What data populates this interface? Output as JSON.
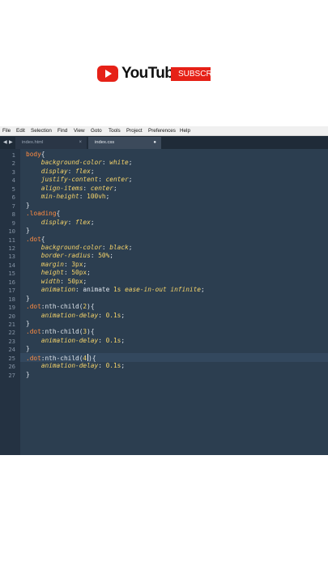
{
  "youtube": {
    "brand": "YouTube",
    "subscribe": "SUBSCR"
  },
  "menu": [
    "File",
    "Edit",
    "Selection",
    "Find",
    "View",
    "Goto",
    "Tools",
    "Project",
    "Preferences",
    "Help"
  ],
  "tabs": [
    {
      "label": "index.html",
      "close": "×"
    },
    {
      "label": "index.css",
      "close": "●"
    }
  ],
  "nav": {
    "back": "◀",
    "forward": "▶"
  },
  "line_numbers": [
    "1",
    "2",
    "3",
    "4",
    "5",
    "6",
    "7",
    "8",
    "9",
    "10",
    "11",
    "12",
    "13",
    "14",
    "15",
    "16",
    "17",
    "18",
    "19",
    "20",
    "21",
    "22",
    "23",
    "24",
    "25",
    "26",
    "27"
  ],
  "code": [
    [
      {
        "t": "body",
        "c": "sel"
      },
      {
        "t": "{",
        "c": "br"
      }
    ],
    [
      {
        "t": "    "
      },
      {
        "t": "background-color",
        "c": "prop"
      },
      {
        "t": ": "
      },
      {
        "t": "white",
        "c": "val"
      },
      {
        "t": ";"
      }
    ],
    [
      {
        "t": "    "
      },
      {
        "t": "display",
        "c": "prop"
      },
      {
        "t": ": "
      },
      {
        "t": "flex",
        "c": "val"
      },
      {
        "t": ";"
      }
    ],
    [
      {
        "t": "    "
      },
      {
        "t": "justify-content",
        "c": "prop"
      },
      {
        "t": ": "
      },
      {
        "t": "center",
        "c": "val"
      },
      {
        "t": ";"
      }
    ],
    [
      {
        "t": "    "
      },
      {
        "t": "align-items",
        "c": "prop"
      },
      {
        "t": ": "
      },
      {
        "t": "center",
        "c": "val"
      },
      {
        "t": ";"
      }
    ],
    [
      {
        "t": "    "
      },
      {
        "t": "min-height",
        "c": "prop"
      },
      {
        "t": ": "
      },
      {
        "t": "100vh",
        "c": "num"
      },
      {
        "t": ";"
      }
    ],
    [
      {
        "t": "}"
      }
    ],
    [
      {
        "t": ".loading",
        "c": "sel"
      },
      {
        "t": "{"
      }
    ],
    [
      {
        "t": "    "
      },
      {
        "t": "display",
        "c": "prop"
      },
      {
        "t": ": "
      },
      {
        "t": "flex",
        "c": "val"
      },
      {
        "t": ";"
      }
    ],
    [
      {
        "t": "}"
      }
    ],
    [
      {
        "t": ".dot",
        "c": "sel"
      },
      {
        "t": "{"
      }
    ],
    [
      {
        "t": "    "
      },
      {
        "t": "background-color",
        "c": "prop"
      },
      {
        "t": ": "
      },
      {
        "t": "black",
        "c": "val"
      },
      {
        "t": ";"
      }
    ],
    [
      {
        "t": "    "
      },
      {
        "t": "border-radius",
        "c": "prop"
      },
      {
        "t": ": "
      },
      {
        "t": "50%",
        "c": "num"
      },
      {
        "t": ";"
      }
    ],
    [
      {
        "t": "    "
      },
      {
        "t": "margin",
        "c": "prop"
      },
      {
        "t": ": "
      },
      {
        "t": "3px",
        "c": "num"
      },
      {
        "t": ";"
      }
    ],
    [
      {
        "t": "    "
      },
      {
        "t": "height",
        "c": "prop"
      },
      {
        "t": ": "
      },
      {
        "t": "50px",
        "c": "num"
      },
      {
        "t": ";"
      }
    ],
    [
      {
        "t": "    "
      },
      {
        "t": "width",
        "c": "prop"
      },
      {
        "t": ": "
      },
      {
        "t": "50px",
        "c": "num"
      },
      {
        "t": ";"
      }
    ],
    [
      {
        "t": "    "
      },
      {
        "t": "animation",
        "c": "prop"
      },
      {
        "t": ": animate "
      },
      {
        "t": "1s",
        "c": "num"
      },
      {
        "t": " "
      },
      {
        "t": "ease-in-out",
        "c": "val"
      },
      {
        "t": " "
      },
      {
        "t": "infinite",
        "c": "val"
      },
      {
        "t": ";"
      }
    ],
    [
      {
        "t": "}"
      }
    ],
    [
      {
        "t": ".dot",
        "c": "sel"
      },
      {
        "t": ":nth-child("
      },
      {
        "t": "2",
        "c": "num"
      },
      {
        "t": "){"
      }
    ],
    [
      {
        "t": "    "
      },
      {
        "t": "animation-delay",
        "c": "prop"
      },
      {
        "t": ": "
      },
      {
        "t": "0.1s",
        "c": "num"
      },
      {
        "t": ";"
      }
    ],
    [
      {
        "t": "}"
      }
    ],
    [
      {
        "t": ".dot",
        "c": "sel"
      },
      {
        "t": ":nth-child("
      },
      {
        "t": "3",
        "c": "num"
      },
      {
        "t": "){"
      }
    ],
    [
      {
        "t": "    "
      },
      {
        "t": "animation-delay",
        "c": "prop"
      },
      {
        "t": ": "
      },
      {
        "t": "0.1s",
        "c": "num"
      },
      {
        "t": ";"
      }
    ],
    [
      {
        "t": "}"
      }
    ],
    [
      {
        "t": ".dot",
        "c": "sel"
      },
      {
        "t": ":nth-child("
      },
      {
        "t": "4",
        "c": "num"
      },
      {
        "t": "CARET"
      },
      {
        "t": "){"
      }
    ],
    [
      {
        "t": "    "
      },
      {
        "t": "animation-delay",
        "c": "prop"
      },
      {
        "t": ": "
      },
      {
        "t": "0.1s",
        "c": "num"
      },
      {
        "t": ";"
      }
    ],
    [
      {
        "t": "}"
      }
    ]
  ],
  "colors": {
    "editor_bg": "#2c3e50",
    "selector": "#ff8c42",
    "property": "#f6d46a",
    "youtube_red": "#e62117"
  }
}
